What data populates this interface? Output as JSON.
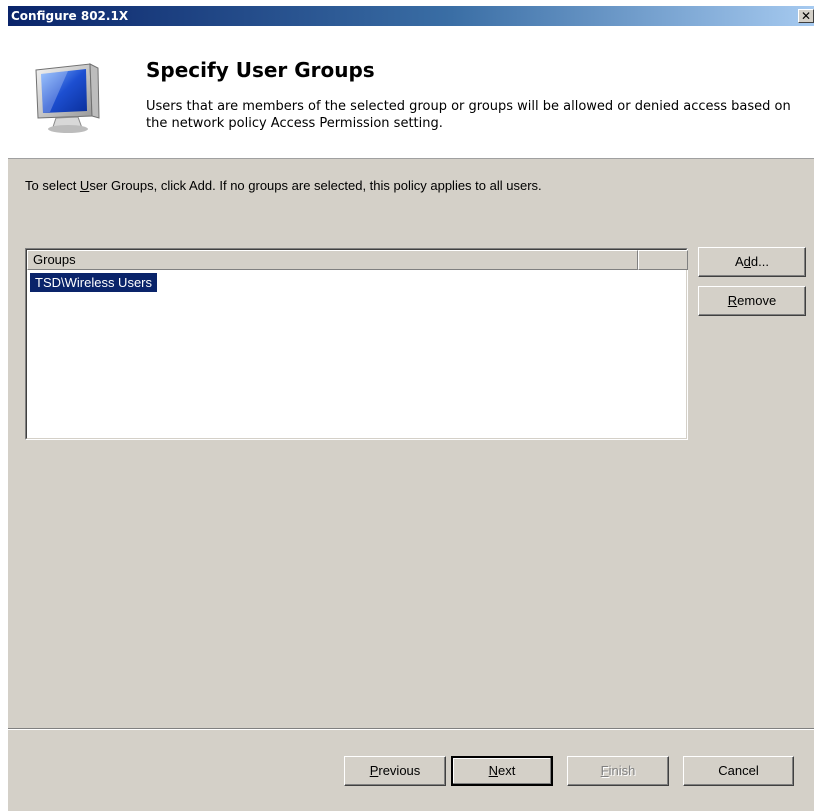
{
  "window": {
    "title": "Configure 802.1X",
    "close_glyph": "✕"
  },
  "header": {
    "title": "Specify User Groups",
    "description": "Users that are members of the selected group or groups will be allowed or denied access based on the network policy Access Permission setting.",
    "icon": "monitor-icon"
  },
  "instruction": {
    "before": "To select ",
    "access_key": "U",
    "after": "ser Groups, click Add. If no groups are selected, this policy applies to all users."
  },
  "groups_list": {
    "columns": [
      "Groups",
      ""
    ],
    "items": [
      "TSD\\Wireless Users"
    ],
    "selected_index": 0
  },
  "side_buttons": {
    "add": {
      "before": "A",
      "key": "d",
      "after": "d..."
    },
    "remove": {
      "before": "",
      "key": "R",
      "after": "emove"
    }
  },
  "footer_buttons": {
    "previous": {
      "before": "",
      "key": "P",
      "after": "revious"
    },
    "next": {
      "before": "",
      "key": "N",
      "after": "ext"
    },
    "finish": {
      "before": "",
      "key": "F",
      "after": "inish",
      "disabled": true
    },
    "cancel": {
      "label": "Cancel"
    }
  },
  "colors": {
    "selection": "#0a246a",
    "dialog_bg": "#d4d0c8"
  }
}
